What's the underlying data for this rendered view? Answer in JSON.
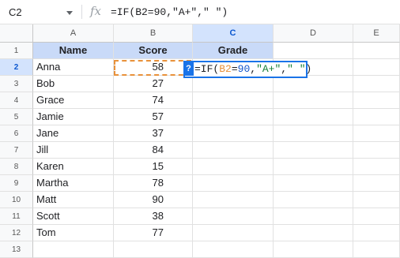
{
  "formula_bar": {
    "name_box": "C2",
    "fx_label": "fx",
    "formula_text": "=IF(B2=90,\"A+\",\" \")"
  },
  "columns": [
    "A",
    "B",
    "C",
    "D",
    "E"
  ],
  "rows": [
    "1",
    "2",
    "3",
    "4",
    "5",
    "6",
    "7",
    "8",
    "9",
    "10",
    "11",
    "12",
    "13"
  ],
  "header_row": {
    "name": "Name",
    "score": "Score",
    "grade": "Grade"
  },
  "data_rows": [
    {
      "name": "Anna",
      "score": "58"
    },
    {
      "name": "Bob",
      "score": "27"
    },
    {
      "name": "Grace",
      "score": "74"
    },
    {
      "name": "Jamie",
      "score": "57"
    },
    {
      "name": "Jane",
      "score": "37"
    },
    {
      "name": "Jill",
      "score": "84"
    },
    {
      "name": "Karen",
      "score": "15"
    },
    {
      "name": "Martha",
      "score": "78"
    },
    {
      "name": "Matt",
      "score": "90"
    },
    {
      "name": "Scott",
      "score": "38"
    },
    {
      "name": "Tom",
      "score": "77"
    }
  ],
  "editor": {
    "help_label": "?",
    "tok_if": "=IF(",
    "tok_ref": "B2",
    "tok_eq": "=",
    "tok_num": "90",
    "tok_comma1": ",",
    "tok_str1": "\"A+\"",
    "tok_comma2": ",",
    "tok_str2": "\" \"",
    "tok_close": ")"
  },
  "colors": {
    "header_fill": "#c9daf8",
    "selection_blue": "#1a73e8",
    "reference_orange": "#e8913a"
  }
}
